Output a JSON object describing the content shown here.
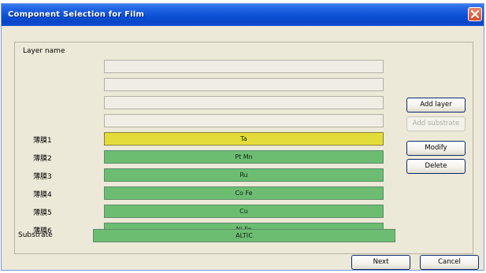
{
  "window": {
    "title": "Component Selection for Film"
  },
  "colors": {
    "active_layer": "#e4dc3a",
    "layer": "#6cbd72",
    "substrate": "#6cbd72"
  },
  "form": {
    "layer_name_label": "Layer name",
    "empty_rows": 4,
    "layers": [
      {
        "label": "薄膜1",
        "value": "Ta",
        "active": true
      },
      {
        "label": "薄膜2",
        "value": "Pt Mn",
        "active": false
      },
      {
        "label": "薄膜3",
        "value": "Ru",
        "active": false
      },
      {
        "label": "薄膜4",
        "value": "Co Fe",
        "active": false
      },
      {
        "label": "薄膜5",
        "value": "Cu",
        "active": false
      },
      {
        "label": "薄膜6",
        "value": "Ni Fe",
        "active": false
      }
    ],
    "substrate": {
      "label": "Substrate",
      "value": "ALTIC"
    }
  },
  "buttons": {
    "add_layer": "Add layer",
    "add_substrate": "Add substrate",
    "modify": "Modify",
    "delete": "Delete",
    "next": "Next",
    "cancel": "Cancel"
  }
}
